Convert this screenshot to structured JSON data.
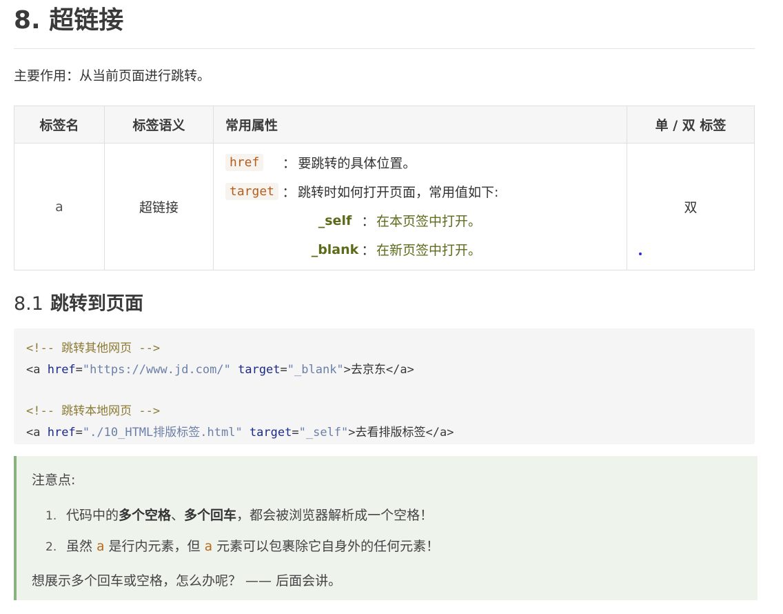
{
  "heading": "8. 超链接",
  "intro": "主要作用：从当前页面进行跳转。",
  "table": {
    "headers": [
      "标签名",
      "标签语义",
      "常用属性",
      "单 / 双 标签"
    ],
    "row": {
      "name": "a",
      "semantic": "超链接",
      "attrs": [
        {
          "code": "href",
          "colon": "：",
          "desc": "要跳转的具体位置。"
        },
        {
          "code": "target",
          "colon": "：",
          "desc": "跳转时如何打开页面，常用值如下:"
        }
      ],
      "values": [
        {
          "label": "_self",
          "colon": "：",
          "desc": "在本页签中打开。"
        },
        {
          "label": "_blank",
          "colon": "：",
          "desc": "在新页签中打开。"
        }
      ],
      "type": "双"
    }
  },
  "subheading": {
    "num": "8.1",
    "text": "跳转到页面"
  },
  "code": {
    "comment1": "<!-- 跳转其他网页 -->",
    "l1": {
      "open": "<a ",
      "href_attr": "href",
      "eq1": "=",
      "href_val": "\"https://www.jd.com/\"",
      "target_attr": "target",
      "eq2": "=",
      "target_val": "\"_blank\"",
      "gt": ">",
      "text": "去京东",
      "close": "</a>"
    },
    "comment2": "<!-- 跳转本地网页 -->",
    "l2": {
      "open": "<a ",
      "href_attr": "href",
      "eq1": "=",
      "href_val": "\"./10_HTML排版标签.html\"",
      "target_attr": "target",
      "eq2": "=",
      "target_val": "\"_self\"",
      "gt": ">",
      "text": "去看排版标签",
      "close": "</a>"
    }
  },
  "note": {
    "title": "注意点:",
    "item1": {
      "num": "1.",
      "pre": "代码中的",
      "b1": "多个空格",
      "sep": "、",
      "b2": "多个回车",
      "post": "，都会被浏览器解析成一个空格！"
    },
    "item2": {
      "num": "2.",
      "pre": "虽然 ",
      "a1": "a",
      "mid": " 是行内元素，但 ",
      "a2": "a",
      "post": " 元素可以包裹除它自身外的任何元素！"
    },
    "footer": "想展示多个回车或空格，怎么办呢？ —— 后面会讲。"
  },
  "colors": {
    "accent_border": "#8ab27e",
    "value_green": "#5b6b1a",
    "inline_code": "#b65d1c"
  }
}
